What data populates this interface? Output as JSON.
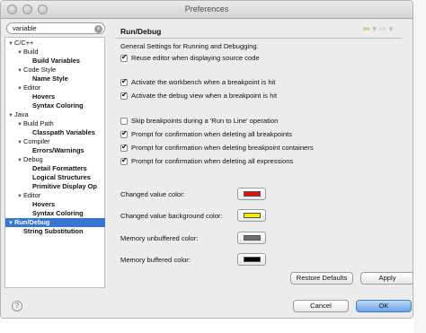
{
  "window": {
    "title": "Preferences"
  },
  "search": {
    "value": "variable",
    "clear_glyph": "×"
  },
  "tree": [
    {
      "label": "C/C++",
      "toggle": "▼",
      "bold": false
    },
    {
      "label": "Build",
      "toggle": "▼",
      "bold": false
    },
    {
      "label": "Build Variables",
      "toggle": "",
      "bold": true
    },
    {
      "label": "Code Style",
      "toggle": "▼",
      "bold": false
    },
    {
      "label": "Name Style",
      "toggle": "",
      "bold": true
    },
    {
      "label": "Editor",
      "toggle": "▼",
      "bold": false
    },
    {
      "label": "Hovers",
      "toggle": "",
      "bold": true
    },
    {
      "label": "Syntax Coloring",
      "toggle": "",
      "bold": true
    },
    {
      "label": "Java",
      "toggle": "▼",
      "bold": false
    },
    {
      "label": "Build Path",
      "toggle": "▼",
      "bold": false
    },
    {
      "label": "Classpath Variables",
      "toggle": "",
      "bold": true
    },
    {
      "label": "Compiler",
      "toggle": "▼",
      "bold": false
    },
    {
      "label": "Errors/Warnings",
      "toggle": "",
      "bold": true
    },
    {
      "label": "Debug",
      "toggle": "▼",
      "bold": false
    },
    {
      "label": "Detail Formatters",
      "toggle": "",
      "bold": true
    },
    {
      "label": "Logical Structures",
      "toggle": "",
      "bold": true
    },
    {
      "label": "Primitive Display Op",
      "toggle": "",
      "bold": true
    },
    {
      "label": "Editor",
      "toggle": "▼",
      "bold": false
    },
    {
      "label": "Hovers",
      "toggle": "",
      "bold": true
    },
    {
      "label": "Syntax Coloring",
      "toggle": "",
      "bold": true
    },
    {
      "label": "Run/Debug",
      "toggle": "▼",
      "bold": true,
      "selected": true
    },
    {
      "label": "String Substitution",
      "toggle": "",
      "bold": true
    }
  ],
  "panel": {
    "title": "Run/Debug",
    "description": "General Settings for Running and Debugging.",
    "nav": {
      "back": "⇦",
      "back_menu": "▾",
      "forward": "⇨",
      "forward_menu": "▾"
    },
    "checkboxes": [
      {
        "label": "Reuse editor when displaying source code",
        "checked": true
      },
      {
        "label": "Activate the workbench when a breakpoint is hit",
        "checked": true
      },
      {
        "label": "Activate the debug view when a breakpoint is hit",
        "checked": true
      },
      {
        "label": "Skip breakpoints during a 'Run to Line' operation",
        "checked": false
      },
      {
        "label": "Prompt for confirmation when deleting all breakpoints",
        "checked": true
      },
      {
        "label": "Prompt for confirmation when deleting breakpoint containers",
        "checked": true
      },
      {
        "label": "Prompt for confirmation when deleting all expressions",
        "checked": true
      }
    ],
    "colors": [
      {
        "label": "Changed value color:",
        "color": "#e01010"
      },
      {
        "label": "Changed value background color:",
        "color": "#f2e800"
      },
      {
        "label": "Memory unbuffered color:",
        "color": "#6e6e6e"
      },
      {
        "label": "Memory buffered color:",
        "color": "#000000"
      }
    ]
  },
  "buttons": {
    "restore_defaults": "Restore Defaults",
    "apply": "Apply",
    "cancel": "Cancel",
    "ok": "OK",
    "help": "?"
  }
}
